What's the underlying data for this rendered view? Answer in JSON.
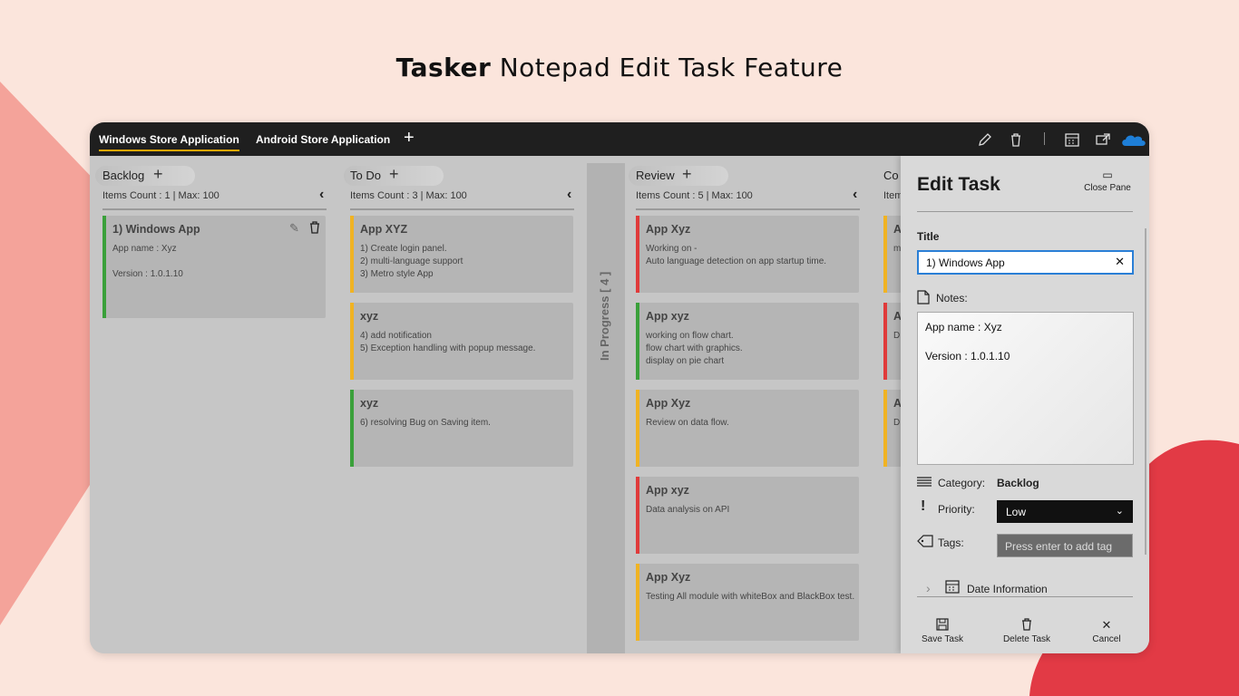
{
  "headline": {
    "bold": "Tasker",
    "rest": " Notepad Edit Task Feature"
  },
  "tabs": [
    {
      "label": "Windows Store Application",
      "active": true
    },
    {
      "label": "Android Store Application",
      "active": false
    }
  ],
  "toolbar_icons": [
    "edit-icon",
    "delete-icon",
    "calendar-icon",
    "export-icon",
    "cloud-icon"
  ],
  "columns": [
    {
      "title": "Backlog",
      "count": "Items Count :  1   |  Max: 100",
      "cards": [
        {
          "title": "1) Windows App",
          "body": "App name : Xyz\n\nVersion : 1.0.1.10",
          "color": "#3aa03a"
        }
      ]
    },
    {
      "title": "To Do",
      "count": "Items Count :  3   |  Max: 100",
      "cards": [
        {
          "title": "App XYZ",
          "body": "1) Create login panel.\n2) multi-language support\n3) Metro style App",
          "color": "#f0b323"
        },
        {
          "title": "xyz",
          "body": "4) add notification\n5) Exception handling with popup message.",
          "color": "#f0b323"
        },
        {
          "title": "xyz",
          "body": "6) resolving Bug on Saving item.",
          "color": "#3aa03a"
        }
      ]
    },
    {
      "inprogress_label": "In Progress [ 4 ]"
    },
    {
      "title": "Review",
      "count": "Items Count :  5   |  Max: 100",
      "cards": [
        {
          "title": "App Xyz",
          "body": "Working on -\nAuto language detection on app startup time.",
          "color": "#e03a3a"
        },
        {
          "title": "App xyz",
          "body": "working on flow chart.\nflow chart with graphics.\ndisplay on pie chart",
          "color": "#3aa03a"
        },
        {
          "title": "App Xyz",
          "body": "Review on data flow.",
          "color": "#f0b323"
        },
        {
          "title": "App xyz",
          "body": "Data analysis on API",
          "color": "#e03a3a"
        },
        {
          "title": "App Xyz",
          "body": "Testing All module with whiteBox and BlackBox test.",
          "color": "#f0b323"
        }
      ]
    },
    {
      "title": "Co",
      "count": "Item",
      "cards": [
        {
          "title": "A",
          "body": "m",
          "color": "#f0b323"
        },
        {
          "title": "A",
          "body": "D",
          "color": "#e03a3a"
        },
        {
          "title": "A",
          "body": "D",
          "color": "#f0b323"
        }
      ]
    }
  ],
  "panel": {
    "title": "Edit Task",
    "close_label": "Close Pane",
    "title_label": "Title",
    "title_value": "1) Windows App",
    "notes_label": "Notes:",
    "notes_value": "App name : Xyz\n\nVersion : 1.0.1.10",
    "category_label": "Category:",
    "category_value": "Backlog",
    "priority_label": "Priority:",
    "priority_value": "Low",
    "tags_label": "Tags:",
    "tags_placeholder": "Press enter to add tag",
    "date_label": "Date Information",
    "actions": {
      "save": "Save Task",
      "delete": "Delete Task",
      "cancel": "Cancel"
    }
  },
  "colors": {
    "accent": "#2a7fd6",
    "green": "#3aa03a",
    "yellow": "#f0b323",
    "red": "#e03a3a",
    "bg": "#fbe5dc"
  }
}
